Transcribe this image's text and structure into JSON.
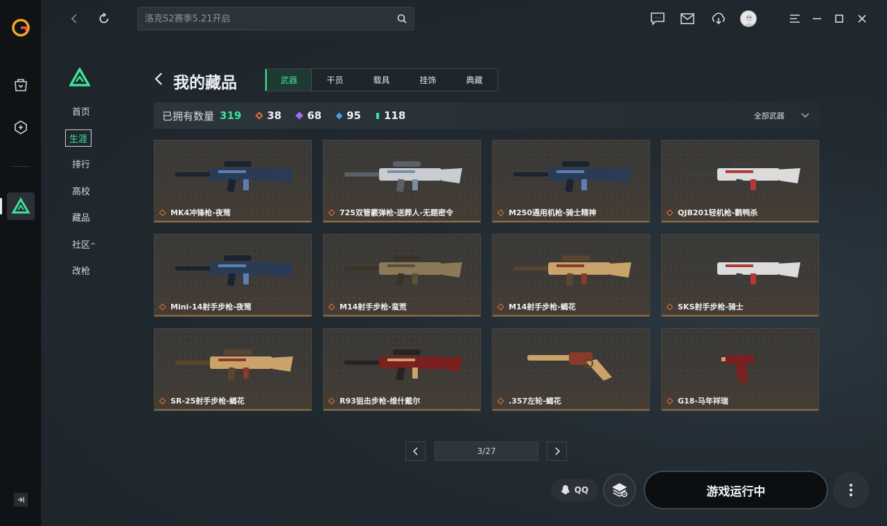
{
  "topbar": {
    "search_placeholder": "洛克S2赛季5.21开启"
  },
  "subnav": {
    "items": [
      {
        "label": "首页",
        "active": false
      },
      {
        "label": "生涯",
        "active": true
      },
      {
        "label": "排行",
        "active": false
      },
      {
        "label": "高校",
        "active": false
      },
      {
        "label": "藏品",
        "active": false
      },
      {
        "label": "社区",
        "active": false,
        "caret": "^"
      },
      {
        "label": "改枪",
        "active": false
      }
    ]
  },
  "page": {
    "title": "我的藏品",
    "tabs": [
      {
        "label": "武器",
        "active": true
      },
      {
        "label": "干员",
        "active": false
      },
      {
        "label": "载具",
        "active": false
      },
      {
        "label": "挂饰",
        "active": false
      },
      {
        "label": "典藏",
        "active": false
      }
    ]
  },
  "stats": {
    "owned_label": "已拥有数量",
    "owned_count": "319",
    "rarities": [
      {
        "count": "38",
        "color": "#e0733a"
      },
      {
        "count": "68",
        "color": "#a66cf0"
      },
      {
        "count": "95",
        "color": "#4c9bf0"
      },
      {
        "count": "118",
        "color": "#3ee39a"
      }
    ],
    "filter_label": "全部武器"
  },
  "items": [
    {
      "name": "MK4冲锋枪-夜莺",
      "palette": "blue"
    },
    {
      "name": "725双管霰弹枪-送葬人-无题密令",
      "palette": "silver"
    },
    {
      "name": "M250通用机枪-骑士精神",
      "palette": "blue"
    },
    {
      "name": "QJB201轻机枪-鹳鸭杀",
      "palette": "white"
    },
    {
      "name": "Mini-14射手步枪-夜莺",
      "palette": "blue"
    },
    {
      "name": "M14射手步枪-蛮荒",
      "palette": "tan"
    },
    {
      "name": "M14射手步枪-蝎花",
      "palette": "gold"
    },
    {
      "name": "SKS射手步枪-骑士",
      "palette": "white"
    },
    {
      "name": "SR-25射手步枪-蝎花",
      "palette": "gold"
    },
    {
      "name": "R93狙击步枪-维什戴尔",
      "palette": "red"
    },
    {
      "name": ".357左轮-蝎花",
      "palette": "gold"
    },
    {
      "name": "G18-马年祥瑞",
      "palette": "red"
    }
  ],
  "pagination": {
    "text": "3/27"
  },
  "footer": {
    "qq_label": "QQ",
    "launch_label": "游戏运行中"
  },
  "colors": {
    "accent": "#3ee39a",
    "card_rarity": "#e0733a"
  }
}
